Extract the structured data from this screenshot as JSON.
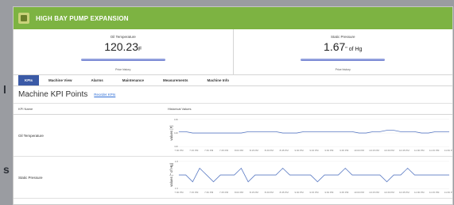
{
  "page_left_labels": [
    "l",
    "s"
  ],
  "header": {
    "title": "HIGH BAY PUMP EXPANSION",
    "logo_icon": "pump-logo-icon",
    "color": "#7db342"
  },
  "kpis": [
    {
      "label": "Oil Temperature",
      "value": "120.23",
      "unit": "F",
      "spark_label": "Price history"
    },
    {
      "label": "Static Pressure",
      "value": "1.67",
      "unit": "\" of Hg",
      "spark_label": "Price history"
    }
  ],
  "tabs": [
    {
      "label": "KPIs",
      "active": true
    },
    {
      "label": "Machine View"
    },
    {
      "label": "Alarms"
    },
    {
      "label": "Maintenance"
    },
    {
      "label": "Measurements"
    },
    {
      "label": "Machine Info"
    }
  ],
  "section": {
    "title": "Machine KPI Points",
    "link": "Reorder KPIs"
  },
  "table": {
    "columns": [
      "KPI Name",
      "Historical Values"
    ]
  },
  "time_ticks": [
    "7:00 PM",
    "7:15 PM",
    "7:30 PM",
    "7:45 PM",
    "8:00 PM",
    "8:15 PM",
    "8:30 PM",
    "8:45 PM",
    "9:00 PM",
    "9:15 PM",
    "9:30 PM",
    "9:45 PM",
    "10:00 PM",
    "10:15 PM",
    "10:30 PM",
    "10:45 PM",
    "11:00 PM",
    "11:15 PM",
    "11:30 PM"
  ],
  "rows": [
    {
      "name": "Oil Temperature",
      "ylabel": "values [F]",
      "yticks": [
        "130",
        "120",
        "110"
      ],
      "series_color": "#5b7bc4",
      "values": [
        121,
        121,
        120,
        120,
        120,
        120,
        120,
        120,
        120,
        120,
        121,
        121,
        121,
        121,
        121,
        120,
        120,
        120,
        121,
        121,
        121,
        121,
        121,
        121,
        121,
        121,
        120,
        120,
        121,
        121,
        122,
        122,
        121,
        121,
        121,
        120,
        120,
        121,
        121,
        121
      ]
    },
    {
      "name": "Static Pressure",
      "ylabel": "values [\" of Hg]",
      "yticks": [
        "1.8",
        "1.6"
      ],
      "series_color": "#5b7bc4",
      "values": [
        1.7,
        1.7,
        1.65,
        1.75,
        1.7,
        1.65,
        1.7,
        1.7,
        1.7,
        1.75,
        1.65,
        1.7,
        1.7,
        1.7,
        1.7,
        1.75,
        1.7,
        1.7,
        1.7,
        1.7,
        1.65,
        1.7,
        1.7,
        1.7,
        1.75,
        1.7,
        1.7,
        1.7,
        1.7,
        1.7,
        1.65,
        1.7,
        1.7,
        1.75,
        1.7,
        1.7,
        1.7,
        1.7,
        1.7,
        1.7
      ]
    }
  ]
}
